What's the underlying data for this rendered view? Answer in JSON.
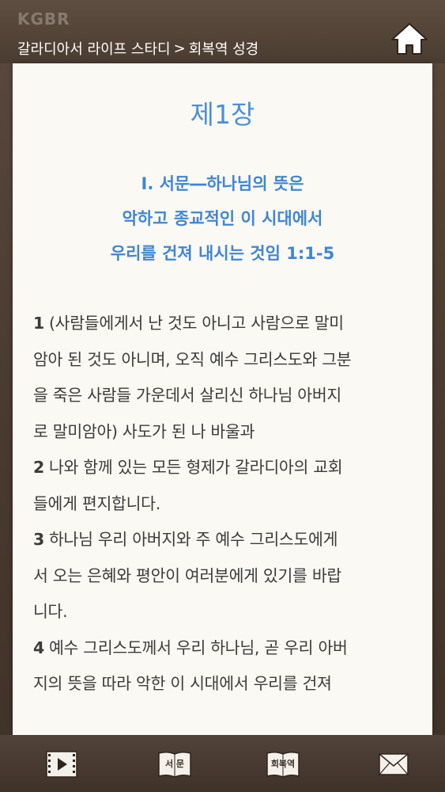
{
  "header": {
    "logo": "KGBR",
    "breadcrumb_parent": "갈라디아서 라이프 스타디",
    "breadcrumb_separator": ">",
    "breadcrumb_current": "회복역 성경"
  },
  "content": {
    "chapter_title": "제1장",
    "section_heading_lines": [
      "Ⅰ. 서문―하나님의 뜻은",
      "악하고 종교적인 이 시대에서",
      "우리를 건져 내시는 것임 1:1-5"
    ],
    "verse_lines": [
      {
        "num": "1",
        "text": "(사람들에게서 난 것도 아니고 사람으로 말미"
      },
      {
        "num": "",
        "text": "암아 된 것도 아니며, 오직 예수 그리스도와 그분"
      },
      {
        "num": "",
        "text": "을 죽은 사람들 가운데서 살리신 하나님 아버지"
      },
      {
        "num": "",
        "text": "로 말미암아) 사도가 된 나 바울과"
      },
      {
        "num": "2",
        "text": "나와 함께 있는 모든 형제가 갈라디아의 교회"
      },
      {
        "num": "",
        "text": "들에게 편지합니다."
      },
      {
        "num": "3",
        "text": "하나님 우리 아버지와 주 예수 그리스도에게"
      },
      {
        "num": "",
        "text": "서 오는 은혜와 평안이 여러분에게 있기를 바랍"
      },
      {
        "num": "",
        "text": "니다."
      },
      {
        "num": "4",
        "text": "예수 그리스도께서 우리 하나님, 곧 우리 아버"
      },
      {
        "num": "",
        "text": "지의 뜻을 따라 악한 이 시대에서 우리를 건져"
      }
    ]
  },
  "bottom_nav": {
    "play_icon": "play-icon",
    "intro_label": "서 문",
    "recovery_label": "회복역",
    "mail_icon": "mail-icon"
  },
  "colors": {
    "frame": "#4b3c31",
    "page": "#fbf9f3",
    "heading_blue": "#4a90d9",
    "body_text": "#3b3b3b"
  }
}
